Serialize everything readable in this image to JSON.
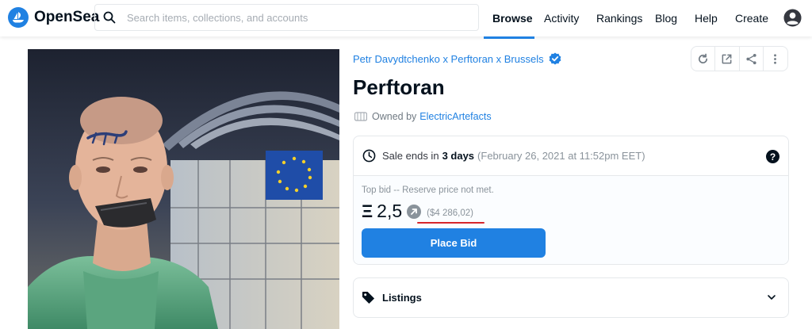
{
  "header": {
    "brand": "OpenSea",
    "search_placeholder": "Search items, collections, and accounts",
    "nav": [
      "Browse",
      "Activity",
      "Rankings",
      "Blog",
      "Help",
      "Create"
    ],
    "active_nav": "Browse"
  },
  "asset": {
    "collection": "Petr Davydtchenko x Perftoran x Brussels",
    "title": "Perftoran",
    "owned_by_prefix": "Owned by",
    "owner": "ElectricArtefacts"
  },
  "sale": {
    "ends_prefix": "Sale ends in",
    "ends_in": "3 days",
    "ends_date": "(February 26, 2021 at 11:52pm EET)",
    "help": "?",
    "top_bid_label": "Top bid -- Reserve price not met.",
    "currency_symbol": "Ξ",
    "price": "2,5",
    "usd": "($4 286,02)",
    "place_bid_label": "Place Bid"
  },
  "listings": {
    "label": "Listings"
  },
  "colors": {
    "accent": "#2081e2",
    "highlight": "#d6262c"
  }
}
